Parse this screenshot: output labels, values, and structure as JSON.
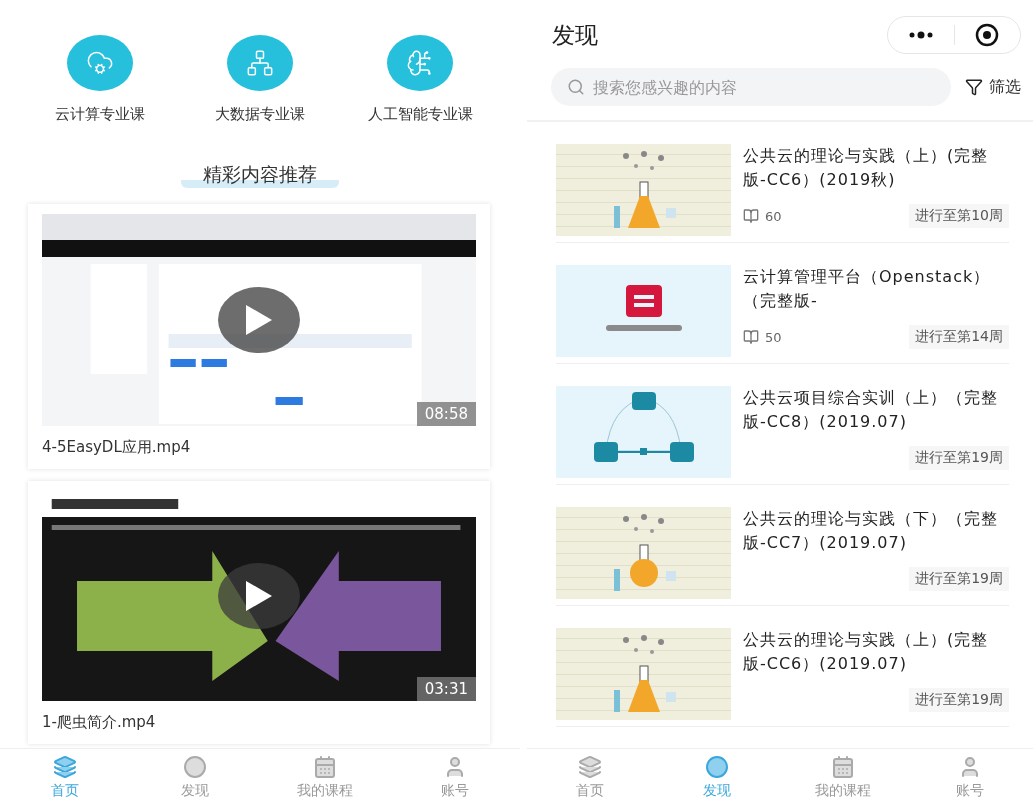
{
  "home": {
    "categories": [
      {
        "label": "云计算专业课"
      },
      {
        "label": "大数据专业课"
      },
      {
        "label": "人工智能专业课"
      }
    ],
    "section_title": "精彩内容推荐",
    "videos": [
      {
        "title": "4-5EasyDL应用.mp4",
        "duration": "08:58"
      },
      {
        "title": "1-爬虫简介.mp4",
        "duration": "03:31"
      }
    ],
    "tab_bar": [
      {
        "label": "首页",
        "selected": true
      },
      {
        "label": "发现",
        "selected": false
      },
      {
        "label": "我的课程",
        "selected": false
      },
      {
        "label": "账号",
        "selected": false
      }
    ]
  },
  "discover": {
    "title": "发现",
    "search": {
      "placeholder": "搜索您感兴趣的内容"
    },
    "filter": "筛选",
    "courses": [
      {
        "title": "公共云的理论与实践（上）(完整版-CC6）(2019秋)",
        "count": "60",
        "progress": "进行至第10周"
      },
      {
        "title": "云计算管理平台（Openstack）（完整版-",
        "count": "50",
        "progress": "进行至第14周"
      },
      {
        "title": "公共云项目综合实训（上）（完整版-CC8）(2019.07)",
        "progress": "进行至第19周"
      },
      {
        "title": "公共云的理论与实践（下）（完整版-CC7）(2019.07)",
        "progress": "进行至第19周"
      },
      {
        "title": "公共云的理论与实践（上）(完整版-CC6）(2019.07)",
        "progress": "进行至第19周"
      }
    ],
    "tab_bar": [
      {
        "label": "首页",
        "selected": false
      },
      {
        "label": "发现",
        "selected": true
      },
      {
        "label": "我的课程",
        "selected": false
      },
      {
        "label": "账号",
        "selected": false
      }
    ]
  }
}
